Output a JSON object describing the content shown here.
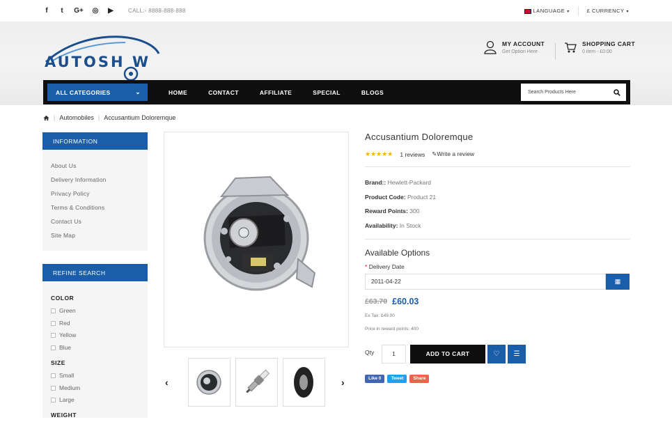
{
  "topbar": {
    "social_icons": [
      "facebook-icon",
      "twitter-icon",
      "google-plus-icon",
      "instagram-icon",
      "youtube-icon"
    ],
    "social_glyphs": [
      "f",
      "t",
      "G+",
      "◎",
      "▶"
    ],
    "call": "CALL:- 8888-888-888",
    "language": "LANGUAGE",
    "currency": "£ CURRENCY"
  },
  "header": {
    "logo_text": "AUTOSH W",
    "account": {
      "title": "MY ACCOUNT",
      "subtitle": "Get Option Here"
    },
    "cart": {
      "title": "SHOPPING CART",
      "subtitle": "0 item - £0.00"
    }
  },
  "nav": {
    "categories": "ALL CATEGORIES",
    "items": [
      "HOME",
      "CONTACT",
      "AFFILIATE",
      "SPECIAL",
      "BLOGS"
    ],
    "search_placeholder": "Search Products Here"
  },
  "breadcrumb": {
    "items": [
      "Automobiles",
      "Accusantium Doloremque"
    ]
  },
  "sidebar": {
    "info_title": "INFORMATION",
    "info_links": [
      "About Us",
      "Delivery Information",
      "Privacy Policy",
      "Terms & Conditions",
      "Contact Us",
      "Site Map"
    ],
    "refine_title": "REFINE SEARCH",
    "color_title": "COLOR",
    "colors": [
      "Green",
      "Red",
      "Yellow",
      "Blue"
    ],
    "size_title": "SIZE",
    "sizes": [
      "Small",
      "Medium",
      "Large"
    ],
    "weight_title": "WEIGHT"
  },
  "product": {
    "title": "Accusantium Doloremque",
    "rating_stars": 5,
    "reviews": "1 reviews",
    "write_review": "Write a review",
    "brand_label": "Brand::",
    "brand": "Hewlett-Packard",
    "code_label": "Product Code:",
    "code": "Product 21",
    "reward_label": "Reward Points:",
    "reward": "300",
    "avail_label": "Availability:",
    "avail": "In Stock",
    "options_title": "Available Options",
    "delivery_label": "Delivery Date",
    "delivery_value": "2011-04-22",
    "old_price": "£63.70",
    "new_price": "£60.03",
    "ex_tax": "Ex Tax: £49.00",
    "reward_price": "Price in reward points: 400",
    "qty_label": "Qty",
    "qty": "1",
    "add_to_cart": "ADD TO CART"
  },
  "share": {
    "like": "Like 0",
    "tweet": "Tweet",
    "share": "Share"
  },
  "colors": {
    "brand_blue": "#1a5da8",
    "nav_black": "#0f0f10",
    "star": "#f5b400"
  }
}
